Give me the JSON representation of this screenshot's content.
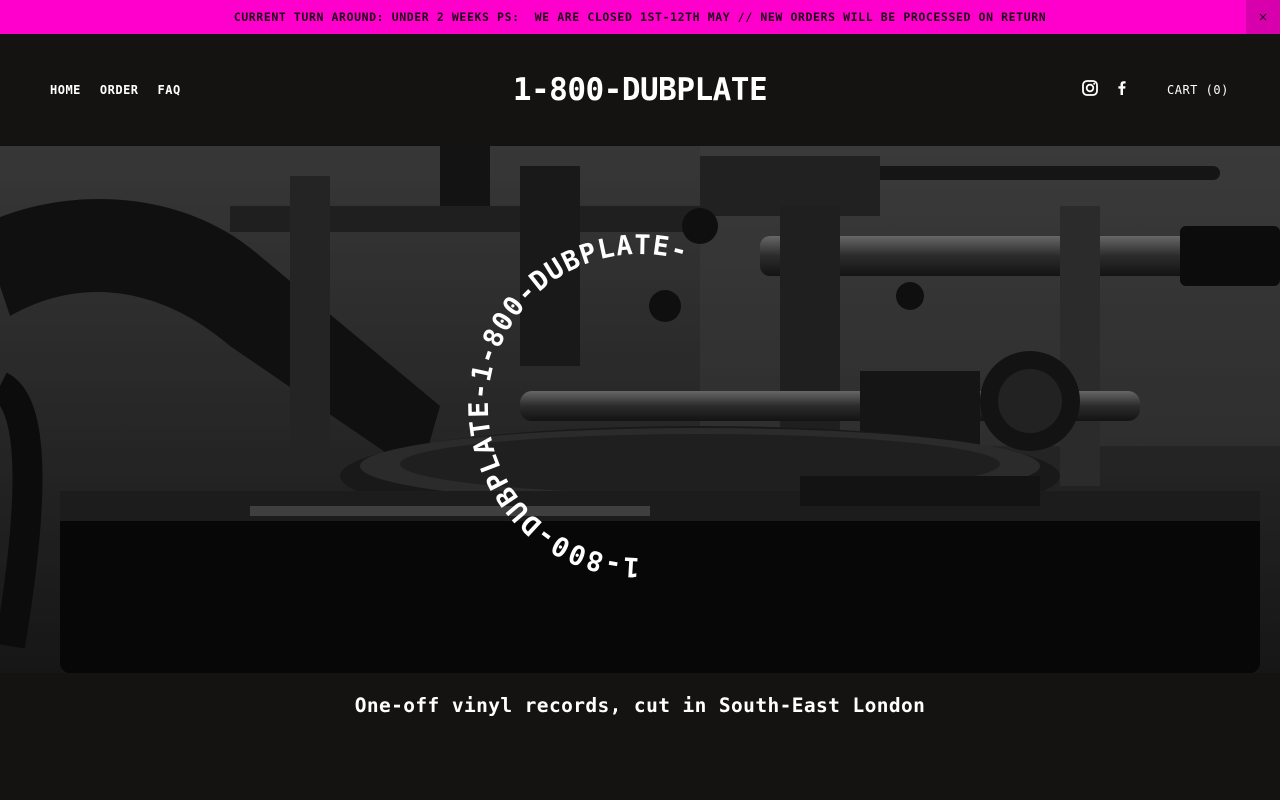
{
  "announcement": {
    "text": "CURRENT TURN AROUND: UNDER 2 WEEKS PS:  WE ARE CLOSED 1ST-12TH MAY // NEW ORDERS WILL BE PROCESSED ON RETURN",
    "close_glyph": "×"
  },
  "header": {
    "nav": [
      {
        "label": "HOME"
      },
      {
        "label": "ORDER"
      },
      {
        "label": "FAQ"
      }
    ],
    "logo": "1-800-DUBPLATE",
    "social": [
      {
        "icon": "instagram-icon"
      },
      {
        "icon": "facebook-icon"
      }
    ],
    "cart_label": "CART (0)"
  },
  "hero": {
    "circle_text": "1-800-DUBPLATE-1-800-DUBPLATE-",
    "image_description_icon": "turntable-lathe-photo"
  },
  "tagline": "One-off vinyl records, cut in South-East London",
  "colors": {
    "announcement_bg": "#ff00cc",
    "page_bg": "#141311",
    "text": "#ffffff"
  }
}
